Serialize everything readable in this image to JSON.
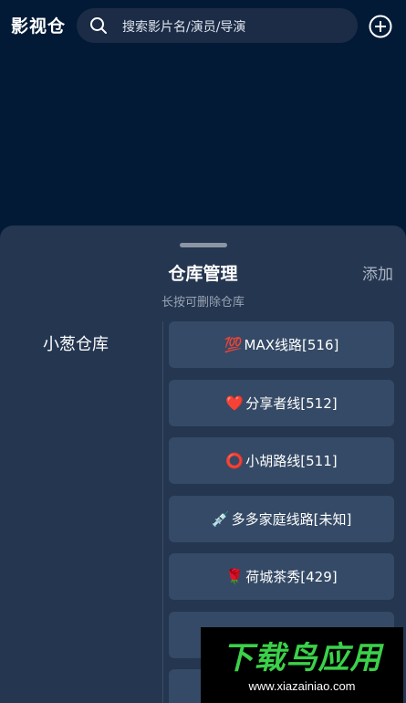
{
  "header": {
    "title": "影视仓",
    "search_placeholder": "搜索影片名/演员/导演",
    "icons": {
      "search": "search-icon",
      "add": "plus-circle-icon"
    }
  },
  "sheet": {
    "title": "仓库管理",
    "subtitle": "长按可删除仓库",
    "add_label": "添加",
    "repositories": [
      {
        "label": "小葱仓库"
      }
    ],
    "lines": [
      {
        "emoji": "💯",
        "label": "MAX线路[516]"
      },
      {
        "emoji": "❤️",
        "label": "分享者线[512]"
      },
      {
        "emoji": "⭕",
        "label": "小胡路线[511]"
      },
      {
        "emoji": "💉",
        "label": "多多家庭线路[未知]"
      },
      {
        "emoji": "🌹",
        "label": "荷城茶秀[429]"
      },
      {
        "emoji": "",
        "label": ""
      },
      {
        "emoji": "",
        "label": ""
      }
    ]
  },
  "watermark": {
    "brand": "下载鸟应用",
    "url": "www.xiazainiao.com"
  },
  "colors": {
    "background": "#021a36",
    "sheet": "#243650",
    "line_button": "#354a66",
    "watermark_green": "#3bd14a"
  }
}
